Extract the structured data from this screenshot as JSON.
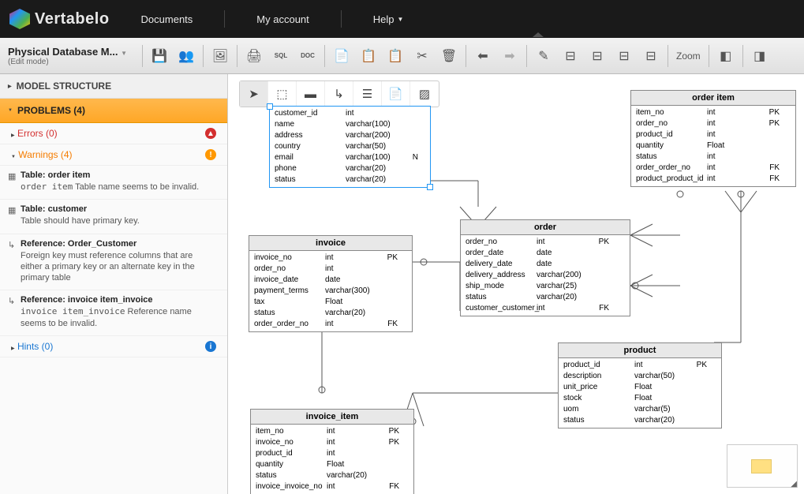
{
  "app": {
    "name": "Vertabelo"
  },
  "topnav": {
    "documents": "Documents",
    "my_account": "My account",
    "help": "Help"
  },
  "doc": {
    "title": "Physical Database M...",
    "mode": "(Edit mode)"
  },
  "toolbar": {
    "zoom": "Zoom"
  },
  "sidebar": {
    "model_structure": "MODEL STRUCTURE",
    "problems": "PROBLEMS (4)",
    "errors": "Errors (0)",
    "warnings": "Warnings (4)",
    "hints": "Hints (0)",
    "issues": [
      {
        "icon": "table",
        "title": "Table: order item",
        "body_pre": "order item",
        "body": " Table name seems to be invalid."
      },
      {
        "icon": "table",
        "title": "Table: customer",
        "body_pre": "",
        "body": "Table should have primary key."
      },
      {
        "icon": "ref",
        "title": "Reference: Order_Customer",
        "body_pre": "",
        "body": "Foreign key must reference columns that are either a primary key or an alternate key in the primary table"
      },
      {
        "icon": "ref",
        "title": "Reference: invoice item_invoice",
        "body_pre": "invoice item_invoice",
        "body": " Reference name seems to be invalid."
      }
    ]
  },
  "entities": {
    "customer": {
      "title": "",
      "rows": [
        {
          "name": "customer_id",
          "type": "int",
          "key": ""
        },
        {
          "name": "name",
          "type": "varchar(100)",
          "key": ""
        },
        {
          "name": "address",
          "type": "varchar(200)",
          "key": ""
        },
        {
          "name": "country",
          "type": "varchar(50)",
          "key": ""
        },
        {
          "name": "email",
          "type": "varchar(100)",
          "key": "N"
        },
        {
          "name": "phone",
          "type": "varchar(20)",
          "key": ""
        },
        {
          "name": "status",
          "type": "varchar(20)",
          "key": ""
        }
      ]
    },
    "order": {
      "title": "order",
      "rows": [
        {
          "name": "order_no",
          "type": "int",
          "key": "PK"
        },
        {
          "name": "order_date",
          "type": "date",
          "key": ""
        },
        {
          "name": "delivery_date",
          "type": "date",
          "key": ""
        },
        {
          "name": "delivery_address",
          "type": "varchar(200)",
          "key": ""
        },
        {
          "name": "ship_mode",
          "type": "varchar(25)",
          "key": ""
        },
        {
          "name": "status",
          "type": "varchar(20)",
          "key": ""
        },
        {
          "name": "customer_customer_",
          "type": "int",
          "key": "FK"
        }
      ]
    },
    "order_item": {
      "title": "order item",
      "rows": [
        {
          "name": "item_no",
          "type": "int",
          "key": "PK"
        },
        {
          "name": "order_no",
          "type": "int",
          "key": "PK"
        },
        {
          "name": "product_id",
          "type": "int",
          "key": ""
        },
        {
          "name": "quantity",
          "type": "Float",
          "key": ""
        },
        {
          "name": "status",
          "type": "int",
          "key": ""
        },
        {
          "name": "order_order_no",
          "type": "int",
          "key": "FK"
        },
        {
          "name": "product_product_id",
          "type": "int",
          "key": "FK"
        }
      ]
    },
    "invoice": {
      "title": "invoice",
      "rows": [
        {
          "name": "invoice_no",
          "type": "int",
          "key": "PK"
        },
        {
          "name": "order_no",
          "type": "int",
          "key": ""
        },
        {
          "name": "invoice_date",
          "type": "date",
          "key": ""
        },
        {
          "name": "payment_terms",
          "type": "varchar(300)",
          "key": ""
        },
        {
          "name": "tax",
          "type": "Float",
          "key": ""
        },
        {
          "name": "status",
          "type": "varchar(20)",
          "key": ""
        },
        {
          "name": "order_order_no",
          "type": "int",
          "key": "FK"
        }
      ]
    },
    "product": {
      "title": "product",
      "rows": [
        {
          "name": "product_id",
          "type": "int",
          "key": "PK"
        },
        {
          "name": "description",
          "type": "varchar(50)",
          "key": ""
        },
        {
          "name": "unit_price",
          "type": "Float",
          "key": ""
        },
        {
          "name": "stock",
          "type": "Float",
          "key": ""
        },
        {
          "name": "uom",
          "type": "varchar(5)",
          "key": ""
        },
        {
          "name": "status",
          "type": "varchar(20)",
          "key": ""
        }
      ]
    },
    "invoice_item": {
      "title": "invoice_item",
      "rows": [
        {
          "name": "item_no",
          "type": "int",
          "key": "PK"
        },
        {
          "name": "invoice_no",
          "type": "int",
          "key": "PK"
        },
        {
          "name": "product_id",
          "type": "int",
          "key": ""
        },
        {
          "name": "quantity",
          "type": "Float",
          "key": ""
        },
        {
          "name": "status",
          "type": "varchar(20)",
          "key": ""
        },
        {
          "name": "invoice_invoice_no",
          "type": "int",
          "key": "FK"
        }
      ]
    }
  }
}
